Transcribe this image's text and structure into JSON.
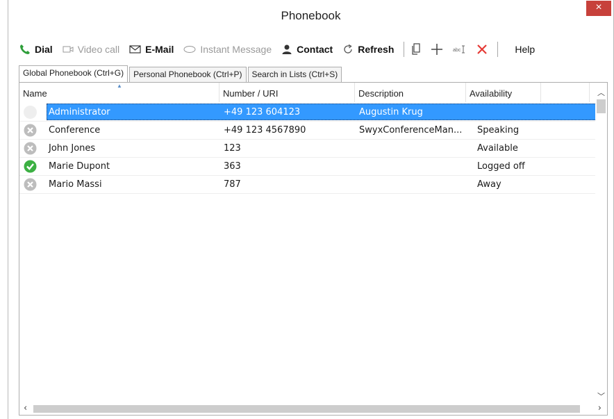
{
  "window": {
    "title": "Phonebook",
    "close_glyph": "×"
  },
  "toolbar": {
    "dial": "Dial",
    "video_call": "Video call",
    "email": "E-Mail",
    "instant_message": "Instant Message",
    "contact": "Contact",
    "refresh": "Refresh",
    "help": "Help",
    "icons": [
      "phone-icon",
      "video-icon",
      "mail-icon",
      "chat-icon",
      "person-icon",
      "refresh-icon",
      "copy-icon",
      "add-icon",
      "rename-icon",
      "delete-icon"
    ]
  },
  "tabs": [
    {
      "label": "Global Phonebook  (Ctrl+G)",
      "active": true
    },
    {
      "label": "Personal Phonebook  (Ctrl+P)",
      "active": false
    },
    {
      "label": "Search in Lists (Ctrl+S)",
      "active": false
    }
  ],
  "table": {
    "columns": [
      "Name",
      "Number / URI",
      "Description",
      "Availability"
    ],
    "rows": [
      {
        "status": "none",
        "name": "Administrator",
        "number": "+49 123 604123",
        "description": "Augustin Krug",
        "availability": "",
        "selected": true
      },
      {
        "status": "grey",
        "name": "Conference",
        "number": "+49 123 4567890",
        "description": "SwyxConferenceMan...",
        "availability": "Speaking",
        "selected": false
      },
      {
        "status": "grey",
        "name": "John Jones",
        "number": "123",
        "description": "",
        "availability": "Available",
        "selected": false
      },
      {
        "status": "green",
        "name": "Marie Dupont",
        "number": "363",
        "description": "",
        "availability": "Logged off",
        "selected": false
      },
      {
        "status": "grey",
        "name": "Mario Massi",
        "number": "787",
        "description": "",
        "availability": "Away",
        "selected": false
      }
    ]
  },
  "colors": {
    "selection": "#3399ff",
    "close": "#c7413b",
    "status_green": "#3cb043",
    "status_grey": "#bdbdbd",
    "delete_red": "#e53935",
    "phone_green": "#2e9e3a"
  }
}
